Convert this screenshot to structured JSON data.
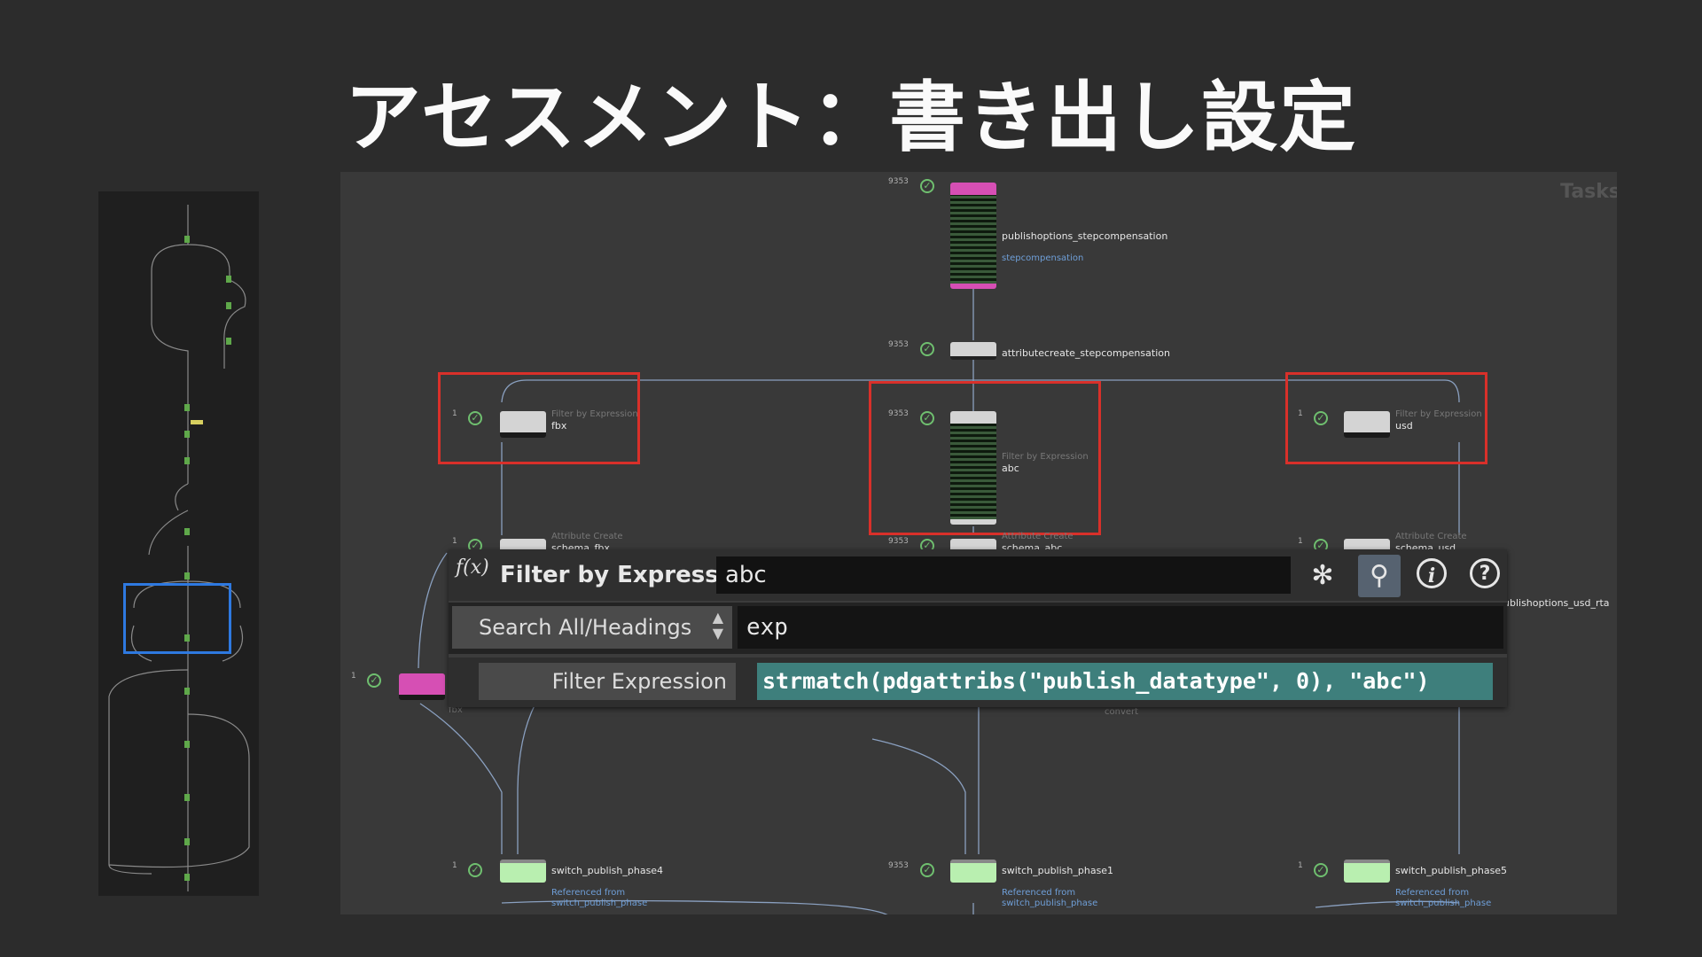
{
  "slide": {
    "title": "アセスメント：書き出し設定"
  },
  "graph": {
    "tasks_label": "Tasks",
    "nodes": {
      "publishoptions": {
        "count": "9353",
        "label": "publishoptions_stepcompensation",
        "ref": "stepcompensation"
      },
      "attributecreate": {
        "count": "9353",
        "label": "attributecreate_stepcompensation"
      },
      "filter_fbx": {
        "count": "1",
        "type": "Filter by Expression",
        "label": "fbx"
      },
      "filter_abc": {
        "count": "9353",
        "type": "Filter by Expression",
        "label": "abc"
      },
      "filter_usd": {
        "count": "1",
        "type": "Filter by Expression",
        "label": "usd"
      },
      "attr_fbx": {
        "count": "1",
        "type": "Attribute Create",
        "label": "schema_fbx"
      },
      "attr_abc": {
        "count": "9353",
        "type": "Attribute Create",
        "label": "schema_abc"
      },
      "attr_usd": {
        "count": "1",
        "type": "Attribute Create",
        "label": "schema_usd"
      },
      "side_label": "ublishoptions_usd_rta",
      "pink_node": {
        "count": "1",
        "label": "fbx"
      },
      "convert_label": "convert",
      "switch4": {
        "count": "1",
        "label": "switch_publish_phase4",
        "ref1": "Referenced from",
        "ref2": "switch_publish_phase"
      },
      "switch1": {
        "count": "9353",
        "label": "switch_publish_phase1",
        "ref1": "Referenced from",
        "ref2": "switch_publish_phase"
      },
      "switch5": {
        "count": "1",
        "label": "switch_publish_phase5",
        "ref1": "Referenced from",
        "ref2": "switch_publish_phase"
      }
    }
  },
  "panel": {
    "fx_icon": "f(x)",
    "title": "Filter by Expression",
    "node_name": "abc",
    "icons": [
      "gear-icon",
      "search-icon",
      "info-icon",
      "help-icon"
    ],
    "search_mode": "Search All/Headings",
    "search_text": "exp",
    "param_label": "Filter Expression",
    "param_value": "strmatch(pdgattribs(\"publish_datatype\", 0), \"abc\")"
  },
  "colors": {
    "highlight_red": "#d9302a",
    "minimap_blue": "#2e79e0",
    "expression_bg": "#3e7f7c",
    "node_pink": "#d64fb4",
    "node_green": "#b9efb0"
  }
}
